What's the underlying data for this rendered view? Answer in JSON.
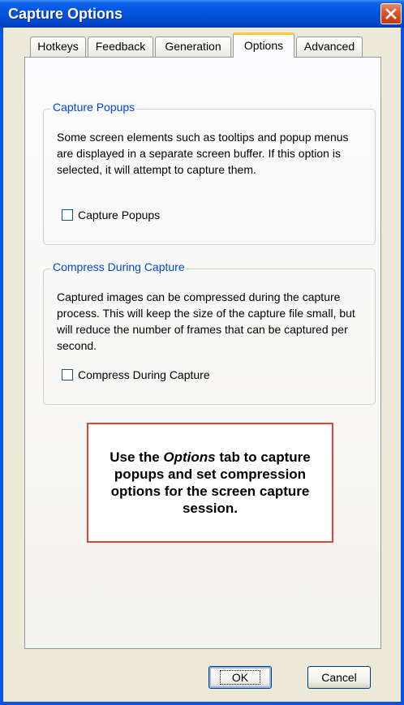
{
  "window": {
    "title": "Capture Options"
  },
  "tabs": [
    {
      "label": "Hotkeys",
      "active": false
    },
    {
      "label": "Feedback",
      "active": false
    },
    {
      "label": "Generation",
      "active": false
    },
    {
      "label": "Options",
      "active": true
    },
    {
      "label": "Advanced",
      "active": false
    }
  ],
  "groups": {
    "popups": {
      "legend": "Capture Popups",
      "description": "Some screen elements such as tooltips and popup menus are displayed in a separate screen buffer. If this option is selected, it will attempt to capture them.",
      "checkbox_label": "Capture Popups",
      "checked": false
    },
    "compress": {
      "legend": "Compress During Capture",
      "description": "Captured images can be compressed during the capture process. This will keep the size of the capture file small, but will reduce the number of frames that can be captured per second.",
      "checkbox_label": "Compress During Capture",
      "checked": false
    }
  },
  "callout": {
    "prefix": "Use the ",
    "emphasis": "Options",
    "suffix": " tab to capture popups and set compression options for the screen capture session."
  },
  "buttons": {
    "ok": "OK",
    "cancel": "Cancel"
  },
  "colors": {
    "titlebar": "#0453dc",
    "close": "#d9532d",
    "group_legend": "#0046d5",
    "callout_border": "#e0433a"
  },
  "icons": {
    "close": "close-icon"
  }
}
